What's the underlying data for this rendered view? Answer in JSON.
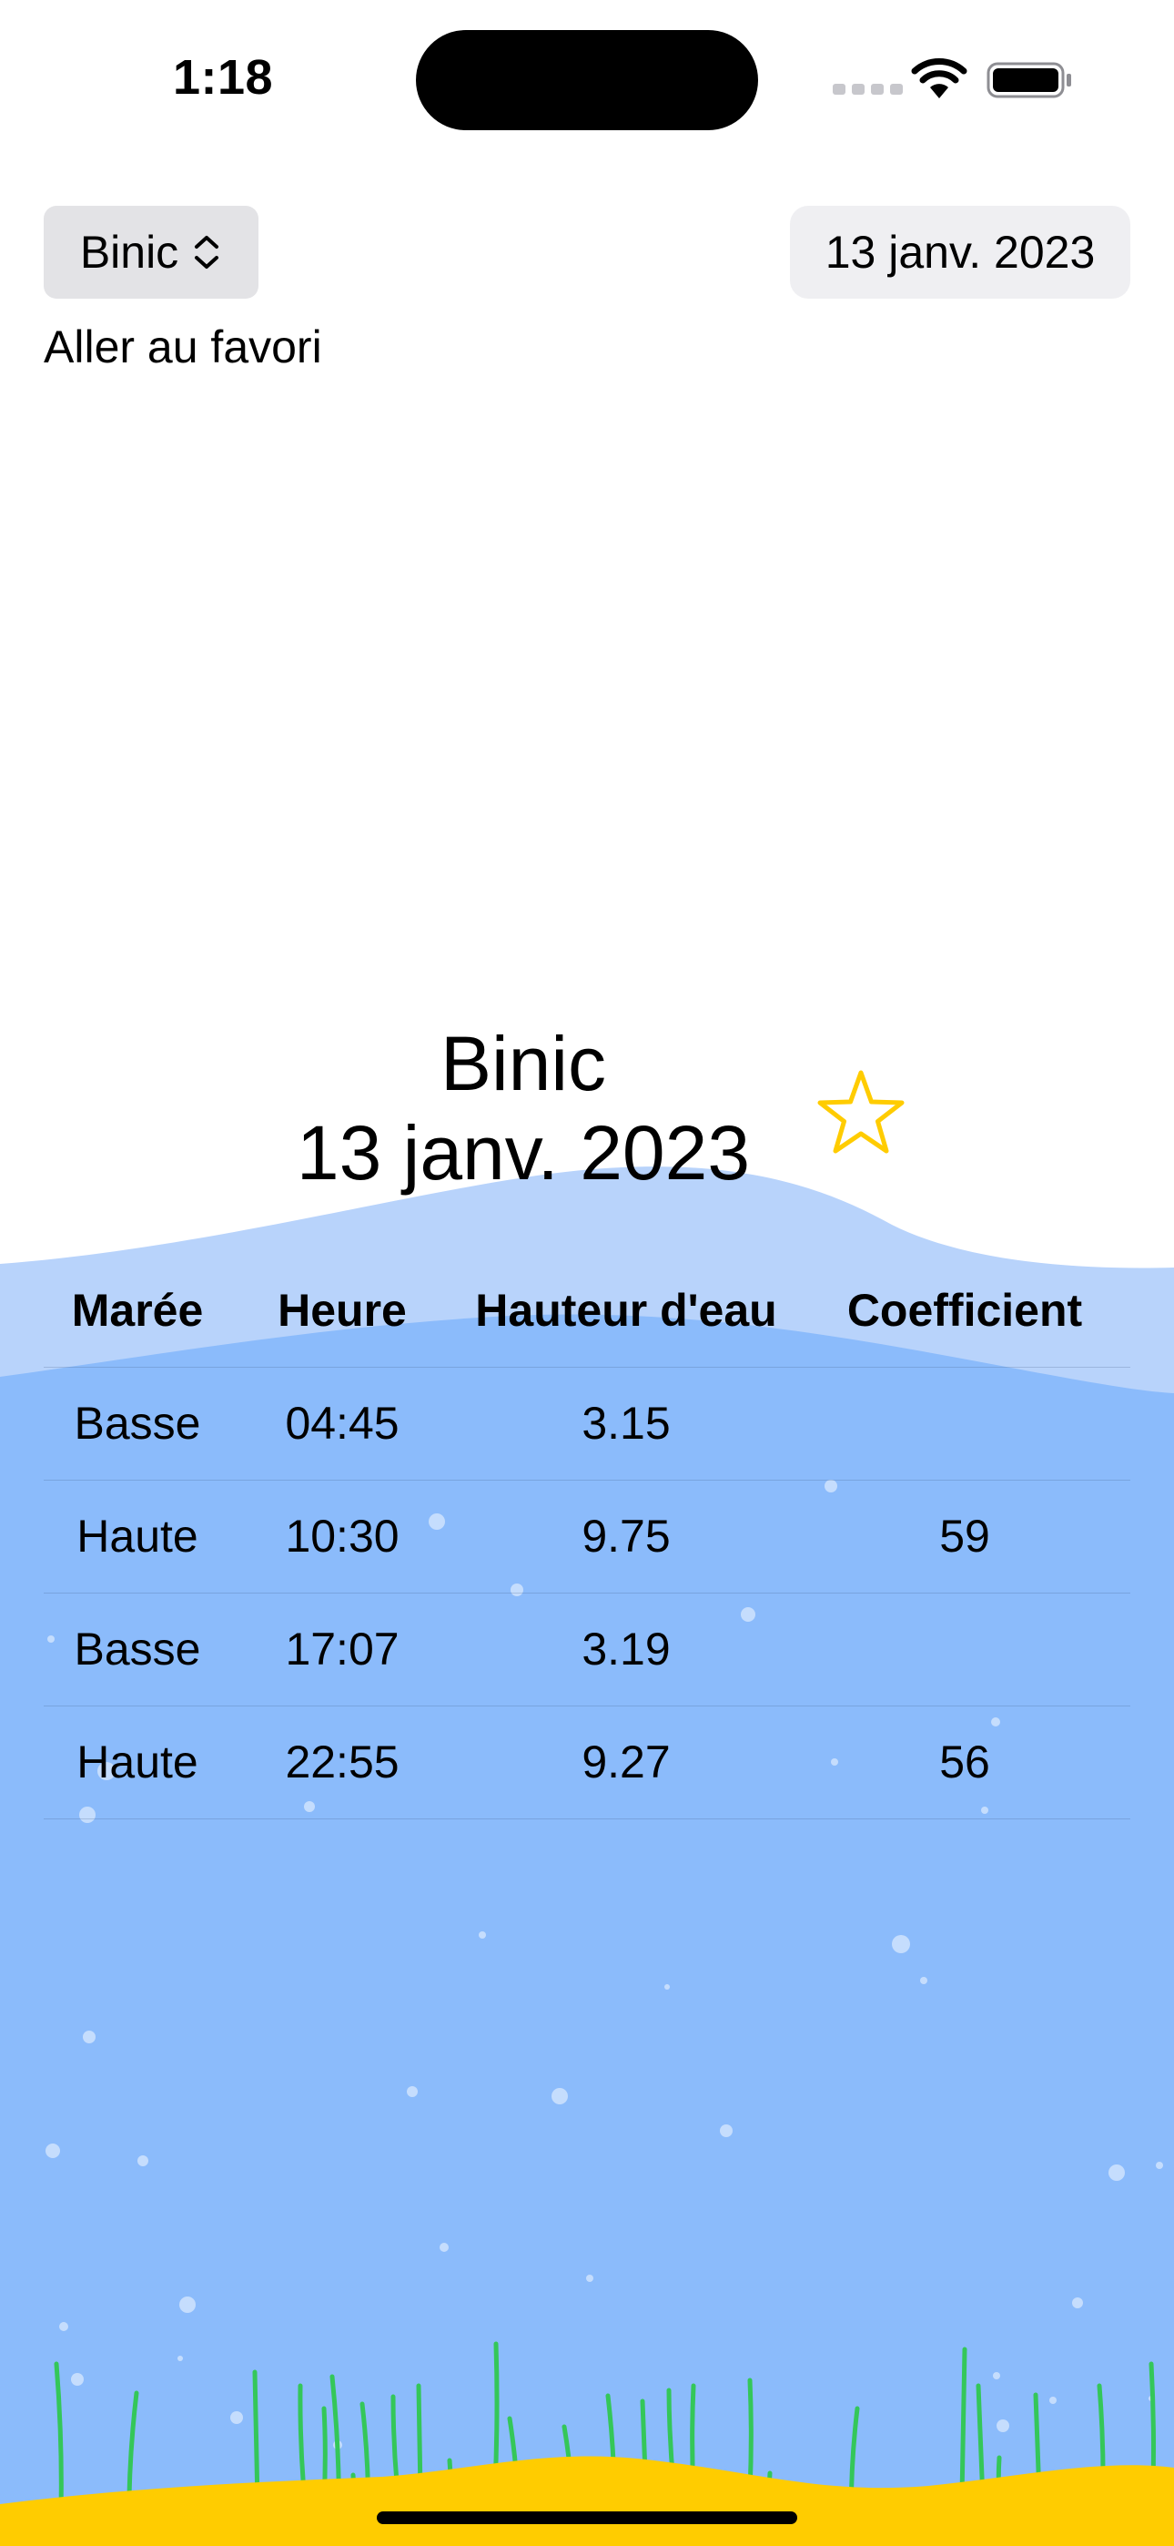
{
  "status_bar": {
    "time": "1:18"
  },
  "toolbar": {
    "location_label": "Binic",
    "date_label": "13 janv. 2023",
    "favorite_link": "Aller au favori"
  },
  "main": {
    "place_title": "Binic",
    "date_title": "13 janv. 2023"
  },
  "table": {
    "headers": [
      "Marée",
      "Heure",
      "Hauteur d'eau",
      "Coefficient"
    ],
    "rows": [
      [
        "Basse",
        "04:45",
        "3.15",
        ""
      ],
      [
        "Haute",
        "10:30",
        "9.75",
        "59"
      ],
      [
        "Basse",
        "17:07",
        "3.19",
        ""
      ],
      [
        "Haute",
        "22:55",
        "9.27",
        "56"
      ]
    ]
  },
  "colors": {
    "water_light": "#b8d3fb",
    "water": "#8bbbfb",
    "seaweed": "#34c759",
    "sand": "#ffcc00",
    "star": "#ffcc00"
  },
  "icons": {
    "picker": "chevron-up-down-icon",
    "favorite": "star-outline-icon"
  }
}
